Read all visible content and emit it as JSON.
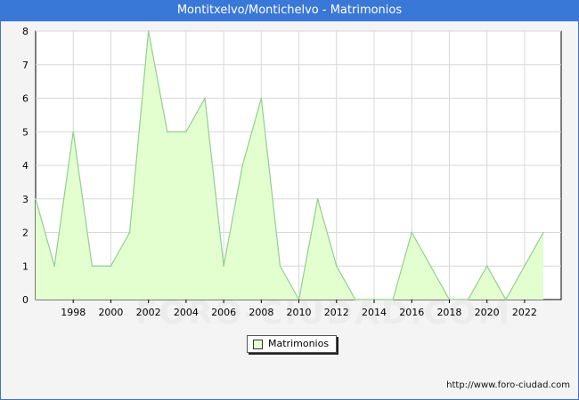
{
  "header": {
    "title": "Montitxelvo/Montichelvo - Matrimonios"
  },
  "footer": {
    "url": "http://www.foro-ciudad.com"
  },
  "watermark": {
    "text": "FORO-CIUDAD.COM"
  },
  "legend": {
    "label": "Matrimonios"
  },
  "colors": {
    "title_bar": "#3a78d8",
    "area_fill": "#e3ffd0",
    "area_line": "#8fd08f",
    "grid": "#d8d8d8"
  },
  "chart_data": {
    "type": "area",
    "title": "Montitxelvo/Montichelvo - Matrimonios",
    "xlabel": "",
    "ylabel": "",
    "x": [
      1996,
      1997,
      1998,
      1999,
      2000,
      2001,
      2002,
      2003,
      2004,
      2005,
      2006,
      2007,
      2008,
      2009,
      2010,
      2011,
      2012,
      2013,
      2014,
      2015,
      2016,
      2017,
      2018,
      2019,
      2020,
      2021,
      2022,
      2023
    ],
    "series": [
      {
        "name": "Matrimonios",
        "values": [
          3,
          1,
          5,
          1,
          1,
          2,
          8,
          5,
          5,
          6,
          1,
          4,
          6,
          1,
          0,
          3,
          1,
          0,
          0,
          0,
          2,
          1,
          0,
          0,
          1,
          0,
          1,
          2
        ]
      }
    ],
    "xticks": [
      "1998",
      "2000",
      "2002",
      "2004",
      "2006",
      "2008",
      "2010",
      "2012",
      "2014",
      "2016",
      "2018",
      "2020",
      "2022"
    ],
    "yticks": [
      "0",
      "1",
      "2",
      "3",
      "4",
      "5",
      "6",
      "7",
      "8"
    ],
    "xlim": [
      1996,
      2023
    ],
    "ylim": [
      0,
      8
    ],
    "grid": true,
    "legend_position": "bottom-center"
  }
}
